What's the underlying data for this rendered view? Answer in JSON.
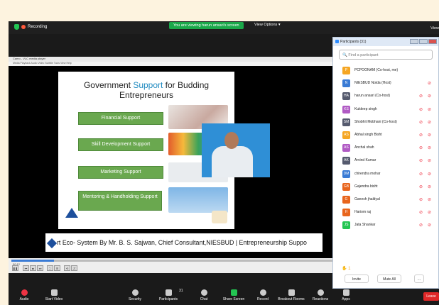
{
  "topbar": {
    "recording_label": "Recording",
    "banner": "You are viewing harun ansari's screen",
    "view_options": "View Options",
    "view_right": "View"
  },
  "player": {
    "title": "Camo - VLC media player",
    "menu": "Media  Playback  Audio  Video  Subtitle  Tools  View  Help",
    "time_left": "00:12",
    "seek_fraction": 0.13
  },
  "slide": {
    "title_pre": "Government ",
    "title_emph": "Support",
    "title_post": " for Budding",
    "title_line2": "Entrepreneurs",
    "boxes": [
      "Financial Support",
      "Skill Development Support",
      "Marketing Support",
      "Mentoring & Handholding Support"
    ],
    "ticker": "rt Eco- System By Mr. B. S. Sajwan, Chief Consultant,NIESBUD | Entrepreneurship Suppo"
  },
  "toolbar": {
    "items": [
      "Audio",
      "Start Video",
      "Security",
      "Participants",
      "Chat",
      "Share Screen",
      "Record",
      "Breakout Rooms",
      "Reactions",
      "Apps"
    ],
    "participants_count": "31",
    "leave_label": "Leave"
  },
  "participants_panel": {
    "title": "Participants (31)",
    "search_placeholder": "Find a participant",
    "participants": [
      {
        "initials": "P",
        "name": "PCPOONAM (Co-host, me)",
        "color": "#f5a623"
      },
      {
        "initials": "N",
        "name": "NIESBUD Noida (Host)",
        "color": "#3a7bd5"
      },
      {
        "initials": "HA",
        "name": "harun ansari (Co-host)",
        "color": "#555a6e"
      },
      {
        "initials": "KS",
        "name": "Kuldeep singh",
        "color": "#b05ac4"
      },
      {
        "initials": "SM",
        "name": "Shobhit Mobhani (Co-host)",
        "color": "#555a6e"
      },
      {
        "initials": "AS",
        "name": "Abhal singh Bisht",
        "color": "#f5a623"
      },
      {
        "initials": "AS",
        "name": "Anchal shah",
        "color": "#b05ac4"
      },
      {
        "initials": "AK",
        "name": "Arvind Kumar",
        "color": "#555a6e"
      },
      {
        "initials": "DM",
        "name": "chirendra mohar",
        "color": "#3a7bd5"
      },
      {
        "initials": "GB",
        "name": "Gajendra bisht",
        "color": "#e8651d"
      },
      {
        "initials": "G",
        "name": "Ganesh jhaldyal",
        "color": "#e8651d"
      },
      {
        "initials": "H",
        "name": "Hariom raj",
        "color": "#e8651d"
      },
      {
        "initials": "JS",
        "name": "Jata Shankar",
        "color": "#23c552"
      }
    ],
    "raised_hands": "1",
    "invite_label": "Invite",
    "mute_all_label": "Mute All",
    "more_label": "..."
  }
}
